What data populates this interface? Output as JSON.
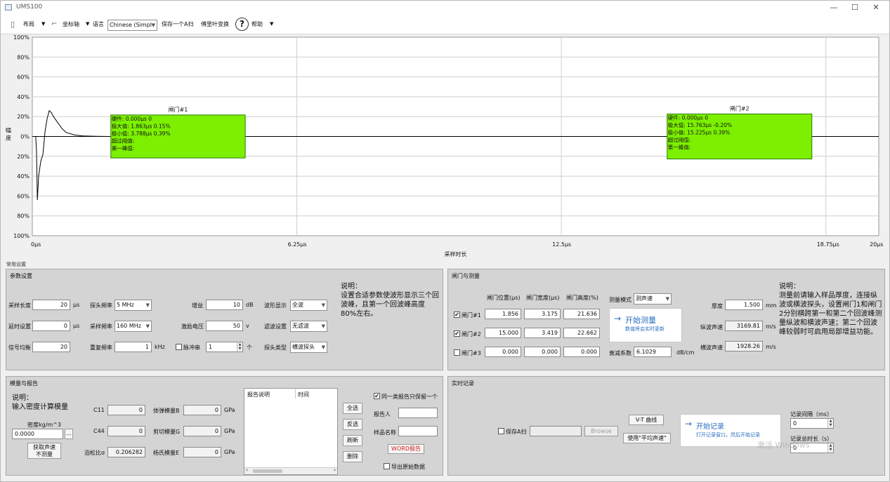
{
  "window": {
    "title": "UMS100"
  },
  "toolbar": {
    "layout": "布局",
    "axis": "坐标轴",
    "language": "语言",
    "language_value": "Chinese (Simpl",
    "save_scan": "保存一个A扫",
    "fourier": "傅里叶变换",
    "help": "帮助"
  },
  "chart_data": {
    "type": "line",
    "xlabel": "采样时长",
    "ylabel": "幅度",
    "xticks": [
      "0μs",
      "6.25μs",
      "12.5μs",
      "18.75μs",
      "20μs"
    ],
    "yticks": [
      "100%",
      "80%",
      "60%",
      "40%",
      "20%",
      "0%",
      "20%",
      "40%",
      "60%",
      "80%",
      "100%"
    ],
    "xlim": [
      0,
      20
    ],
    "ylim": [
      -100,
      100
    ],
    "series": [
      {
        "x": [
          0,
          0.08,
          0.1,
          0.12,
          0.15,
          0.2,
          0.25,
          0.3,
          0.35,
          0.4,
          0.45,
          0.5,
          0.6,
          0.7,
          0.8,
          1.0,
          1.2,
          1.5,
          1.8
        ],
        "y": [
          0,
          0,
          -15,
          -64,
          -40,
          -25,
          -18,
          5,
          18,
          26,
          24,
          20,
          14,
          8,
          4,
          1.5,
          0.5,
          0.2,
          0
        ]
      }
    ],
    "gates": [
      {
        "name": "闸门#1",
        "x_start": 1.856,
        "width": 3.175,
        "height_pct": 21.636,
        "lines": [
          "硬件: 0.000μs 0",
          "极大值: 1.863μs 0.15%",
          "极小值: 3.788μs 0.39%",
          "超过阈值:",
          "第一峰值:"
        ]
      },
      {
        "name": "闸门#2",
        "x_start": 15.0,
        "width": 3.419,
        "height_pct": 22.662,
        "lines": [
          "硬件: 0.000μs 0",
          "极大值: 15.763μs -0.20%",
          "极小值: 15.225μs 0.39%",
          "超过阈值:",
          "第一峰值:"
        ]
      }
    ],
    "colors": {
      "gate": "#7cf000",
      "line": "#000000",
      "grid": "#cfcfcf"
    }
  },
  "section_title": "常用设置",
  "params": {
    "title": "参数设置",
    "sample_length_label": "采样长度",
    "sample_length": "20",
    "sample_length_unit": "μs",
    "delay_label": "延时设置",
    "delay": "0",
    "delay_unit": "μs",
    "avg_label": "信号均衡",
    "avg": "20",
    "probe_freq_label": "探头频率",
    "probe_freq": "5 MHz",
    "sample_freq_label": "采样频率",
    "sample_freq": "160 MHz",
    "rep_freq_label": "重复频率",
    "rep_freq": "1",
    "rep_freq_unit": "kHz",
    "gain_label": "增益",
    "gain": "10",
    "gain_unit": "dB",
    "excite_label": "激励电压",
    "excite": "50",
    "excite_unit": "v",
    "pulse_label": "脉冲串",
    "pulse": "1",
    "pulse_unit": "个",
    "wave_label": "波形显示",
    "wave": "全波",
    "filter_label": "滤波设置",
    "filter": "无滤波",
    "probe_type_label": "探头类型",
    "probe_type": "横波探头",
    "note_title": "说明：",
    "note": "设置合适参数使波形显示三个回波峰，且第一个回波峰高度80%左右。"
  },
  "gates_panel": {
    "title": "闸门与测量",
    "col_pos": "闸门位置(μs)",
    "col_width": "闸门宽度(μs)",
    "col_height": "闸门高度(%)",
    "rows": [
      {
        "label": "闸门#1",
        "checked": "✔",
        "pos": "1.856",
        "width": "3.175",
        "height": "21.636"
      },
      {
        "label": "闸门#2",
        "checked": "✔",
        "pos": "15.000",
        "width": "3.419",
        "height": "22.662"
      },
      {
        "label": "闸门#3",
        "checked": "",
        "pos": "0.000",
        "width": "0.000",
        "height": "0.000"
      }
    ],
    "mode_label": "测量模式",
    "mode": "测声速",
    "start_title": "开始测量",
    "start_sub": "数值将会实时更新",
    "atten_label": "衰减系数",
    "atten": "6.1029",
    "atten_unit": "dB/cm",
    "thickness_label": "厚度",
    "thickness": "1.500",
    "thickness_unit": "mm",
    "long_label": "纵波声速",
    "long": "3169.81",
    "long_unit": "m/s",
    "shear_label": "横波声速",
    "shear": "1928.26",
    "shear_unit": "m/s",
    "note_title": "说明：",
    "note": "测量前请输入样品厚度，连接纵波或横波探头，设置闸门1和闸门2分别横跨第一和第二个回波峰测量纵波和横波声速；第二个回波峰较弱时可启用局部增益功能。"
  },
  "modulus": {
    "title": "模量与报告",
    "note_title": "说明：",
    "note": "输入密度计算模量",
    "density_label": "密度kg/m^3",
    "density": "0.0000",
    "more": "...",
    "get_btn": "获取声速\n不测量",
    "c11_label": "C11",
    "c11": "0",
    "c44_label": "C44",
    "c44": "0",
    "poisson_label": "泊松比σ",
    "poisson": "0.206282",
    "bulk_label": "体弹模量B",
    "bulk": "0",
    "bulk_unit": "GPa",
    "shear_label": "剪切模量G",
    "shear": "0",
    "shear_unit": "GPa",
    "young_label": "杨氏模量E",
    "young": "0",
    "young_unit": "GPa",
    "col_desc": "报告说明",
    "col_time": "时间",
    "btn_all": "全选",
    "btn_invert": "反选",
    "btn_refresh": "刷新",
    "btn_delete": "删除",
    "keep_one": "同一类报告只保留一个",
    "keep_checked": "✔",
    "reporter_label": "报告人",
    "sample_label": "样品名称",
    "word_btn": "WORD报告",
    "export_raw": "导出原始数据"
  },
  "realtime": {
    "title": "实时记录",
    "save_a": "保存A扫",
    "browse": "Browse",
    "vt": "V-T 曲线",
    "use_avg": "使用\"平均声速\"",
    "start_title": "开始记录",
    "start_sub": "打开记录窗口，然后开始记录",
    "interval_label": "记录间隔（ms）",
    "interval": "0",
    "total_label": "记录总时长（s）",
    "total": "0"
  },
  "watermark": "激活 Windows"
}
